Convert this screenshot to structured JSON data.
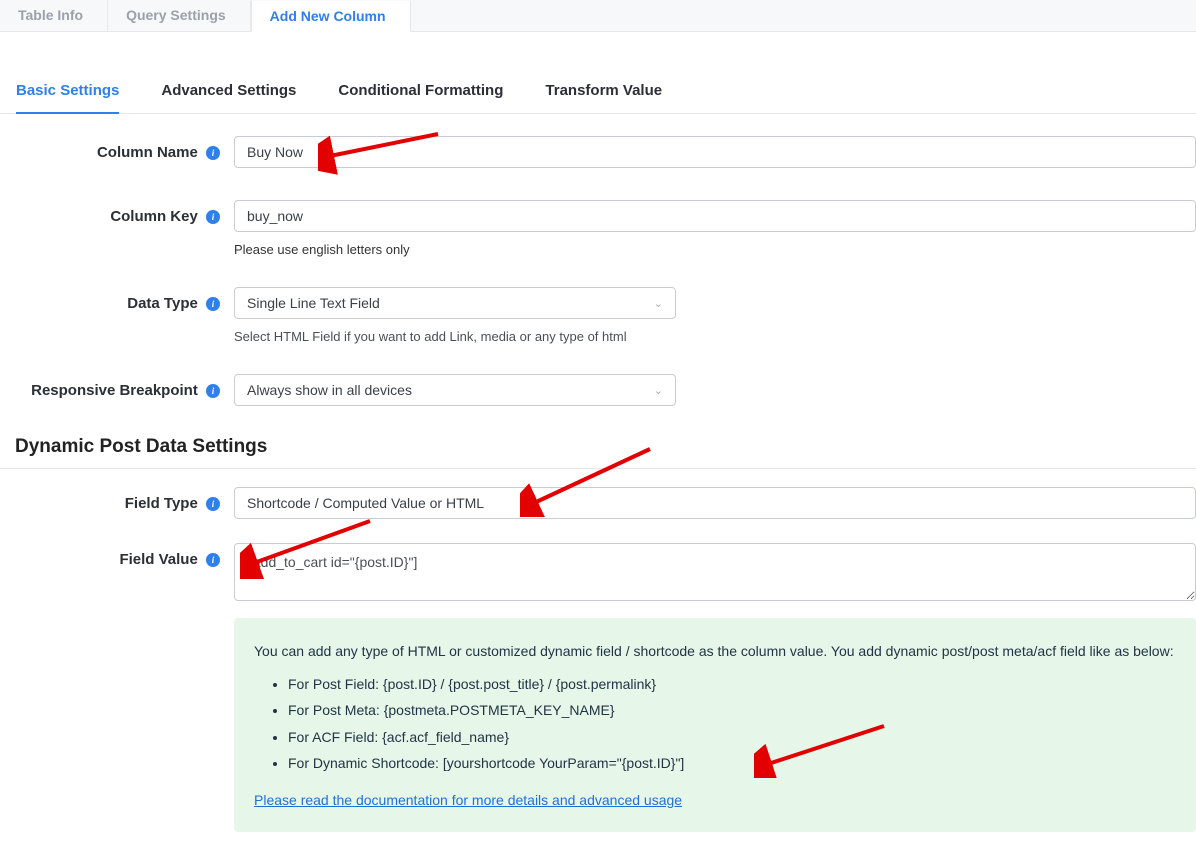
{
  "top_tabs": {
    "table_info": "Table Info",
    "query_settings": "Query Settings",
    "add_new_column": "Add New Column"
  },
  "sub_tabs": {
    "basic": "Basic Settings",
    "advanced": "Advanced Settings",
    "conditional": "Conditional Formatting",
    "transform": "Transform Value"
  },
  "labels": {
    "column_name": "Column Name",
    "column_key": "Column Key",
    "data_type": "Data Type",
    "responsive_breakpoint": "Responsive Breakpoint",
    "field_type": "Field Type",
    "field_value": "Field Value"
  },
  "values": {
    "column_name": "Buy Now",
    "column_key": "buy_now",
    "data_type": "Single Line Text Field",
    "responsive_breakpoint": "Always show in all devices",
    "field_type": "Shortcode / Computed Value or HTML",
    "field_value": "[add_to_cart id=\"{post.ID}\"]"
  },
  "hints": {
    "column_key": "Please use english letters only",
    "data_type": "Select HTML Field if you want to add Link, media or any type of html"
  },
  "section": {
    "dynamic_post": "Dynamic Post Data Settings"
  },
  "green_box": {
    "intro": "You can add any type of HTML or customized dynamic field / shortcode as the column value. You add dynamic post/post meta/acf field like as below:",
    "li1": "For Post Field: {post.ID} / {post.post_title} / {post.permalink}",
    "li2": "For Post Meta: {postmeta.POSTMETA_KEY_NAME}",
    "li3": "For ACF Field: {acf.acf_field_name}",
    "li4": "For Dynamic Shortcode: [yourshortcode YourParam=\"{post.ID}\"]",
    "link": "Please read the documentation for more details and advanced usage"
  },
  "info_glyph": "i"
}
